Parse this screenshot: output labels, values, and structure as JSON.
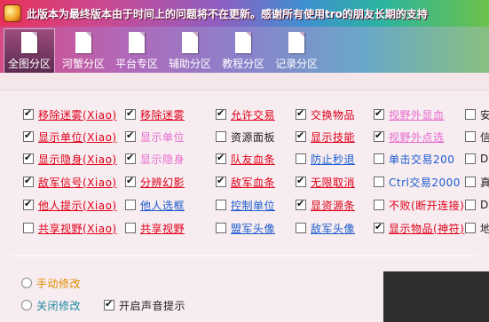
{
  "window": {
    "title": "此版本为最终版本由于时间上的问题将不在更新。感谢所有使用tro的朋友长期的支持"
  },
  "toolbar": {
    "tabs": [
      {
        "label": "全图分区",
        "active": true
      },
      {
        "label": "河蟹分区",
        "active": false
      },
      {
        "label": "平台专区",
        "active": false
      },
      {
        "label": "辅助分区",
        "active": false
      },
      {
        "label": "教程分区",
        "active": false
      },
      {
        "label": "记录分区",
        "active": false
      }
    ]
  },
  "options": {
    "col1": [
      {
        "label": "移除迷雾(Xiao)",
        "checked": true
      },
      {
        "label": "显示单位(Xiao)",
        "checked": true
      },
      {
        "label": "显示隐身(Xiao)",
        "checked": true
      },
      {
        "label": "敌军信号(Xiao)",
        "checked": true
      },
      {
        "label": "他人提示(Xiao)",
        "checked": true
      },
      {
        "label": "共享视野(Xiao)",
        "checked": false
      }
    ],
    "col2": [
      {
        "label": "移除迷雾",
        "checked": true
      },
      {
        "label": "显示单位",
        "checked": true
      },
      {
        "label": "显示隐身",
        "checked": true
      },
      {
        "label": "分辨幻影",
        "checked": true
      },
      {
        "label": "他人选框",
        "checked": false
      },
      {
        "label": "共享视野",
        "checked": false
      }
    ],
    "col3": [
      {
        "label": "允许交易",
        "checked": true
      },
      {
        "label": "资源面板",
        "checked": false
      },
      {
        "label": "队友血条",
        "checked": true
      },
      {
        "label": "敌军血条",
        "checked": true
      },
      {
        "label": "控制单位",
        "checked": false
      },
      {
        "label": "盟军头像",
        "checked": false
      }
    ],
    "col4": [
      {
        "label": "交换物品",
        "checked": true
      },
      {
        "label": "显示技能",
        "checked": true
      },
      {
        "label": "防止秒退",
        "checked": false
      },
      {
        "label": "无限取消",
        "checked": true
      },
      {
        "label": "显资源条",
        "checked": true
      },
      {
        "label": "敌军头像",
        "checked": false
      }
    ],
    "col5": [
      {
        "label": "视野外显血",
        "checked": true
      },
      {
        "label": "视野外点选",
        "checked": true
      },
      {
        "label": "单击交易200",
        "checked": false
      },
      {
        "label": "Ctrl交易2000",
        "checked": false
      },
      {
        "label": "不败(断开连接)",
        "checked": false
      },
      {
        "label": "显示物品(神符)",
        "checked": true
      }
    ],
    "col6": [
      {
        "label": "安",
        "checked": false
      },
      {
        "label": "信",
        "checked": false
      },
      {
        "label": "Do",
        "checked": false
      },
      {
        "label": "真",
        "checked": false
      },
      {
        "label": "Do",
        "checked": false
      },
      {
        "label": "地",
        "checked": false
      }
    ]
  },
  "bottom": {
    "manual_mode": "手动修改",
    "disable_mode": "关闭修改",
    "sound_label": "开启声音提示",
    "sound_checked": true
  }
}
